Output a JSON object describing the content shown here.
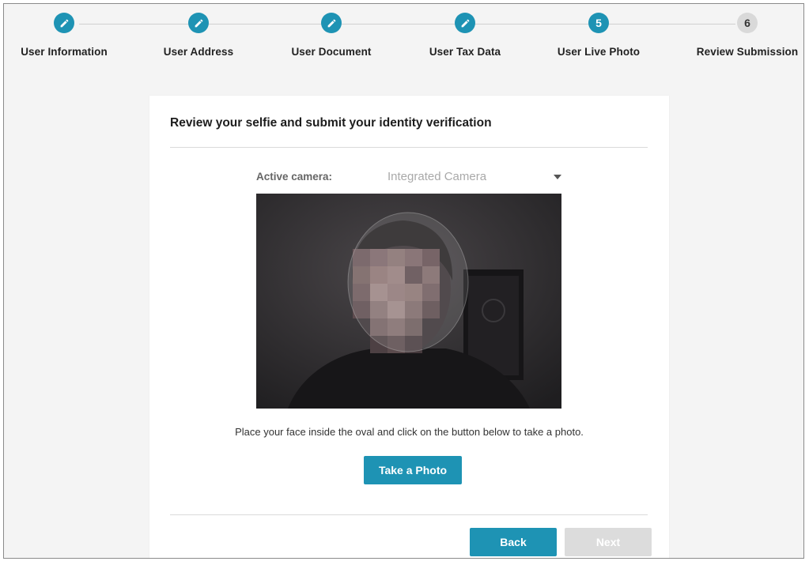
{
  "steps": [
    {
      "label": "User Information",
      "state": "done",
      "icon": "pencil-icon"
    },
    {
      "label": "User Address",
      "state": "done",
      "icon": "pencil-icon"
    },
    {
      "label": "User Document",
      "state": "done",
      "icon": "pencil-icon"
    },
    {
      "label": "User Tax Data",
      "state": "done",
      "icon": "pencil-icon"
    },
    {
      "label": "User Live Photo",
      "state": "current",
      "number": "5"
    },
    {
      "label": "Review Submission",
      "state": "pending",
      "number": "6"
    }
  ],
  "card": {
    "title": "Review your selfie and submit your identity verification",
    "camera_label": "Active camera:",
    "camera_value": "Integrated Camera",
    "hint": "Place your face inside the oval and click on the button below to take a photo.",
    "take_photo_label": "Take a Photo",
    "back_label": "Back",
    "next_label": "Next"
  },
  "colors": {
    "accent": "#1e93b4",
    "pending_step": "#d9d9d9",
    "disabled_button": "#dcdcdc"
  }
}
